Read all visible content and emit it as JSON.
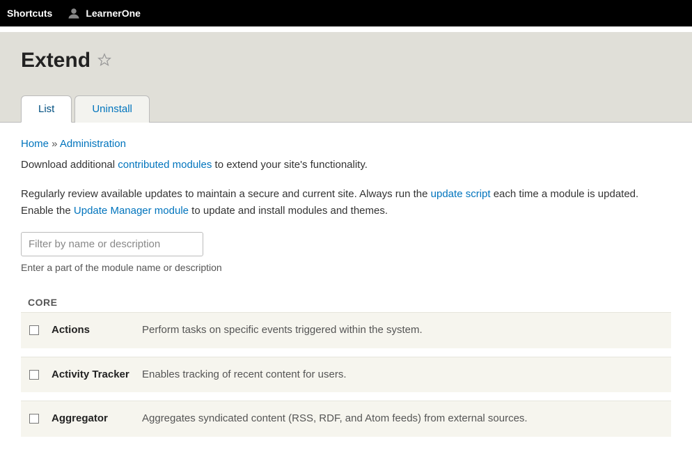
{
  "toolbar": {
    "shortcuts_label": "Shortcuts",
    "username": "LearnerOne"
  },
  "page": {
    "title": "Extend"
  },
  "tabs": {
    "list_label": "List",
    "uninstall_label": "Uninstall"
  },
  "breadcrumb": {
    "home": "Home",
    "sep": " » ",
    "admin": "Administration"
  },
  "intro": {
    "p1_a": "Download additional ",
    "p1_link": "contributed modules",
    "p1_b": " to extend your site's functionality.",
    "p2_a": "Regularly review available updates to maintain a secure and current site. Always run the ",
    "p2_link1": "update script",
    "p2_b": " each time a module is updated. Enable the ",
    "p2_link2": "Update Manager module",
    "p2_c": " to update and install modules and themes."
  },
  "filter": {
    "placeholder": "Filter by name or description",
    "help": "Enter a part of the module name or description"
  },
  "section": {
    "core_label": "CORE"
  },
  "modules": [
    {
      "name": "Actions",
      "desc": "Perform tasks on specific events triggered within the system."
    },
    {
      "name": "Activity Tracker",
      "desc": "Enables tracking of recent content for users."
    },
    {
      "name": "Aggregator",
      "desc": "Aggregates syndicated content (RSS, RDF, and Atom feeds) from external sources."
    }
  ]
}
